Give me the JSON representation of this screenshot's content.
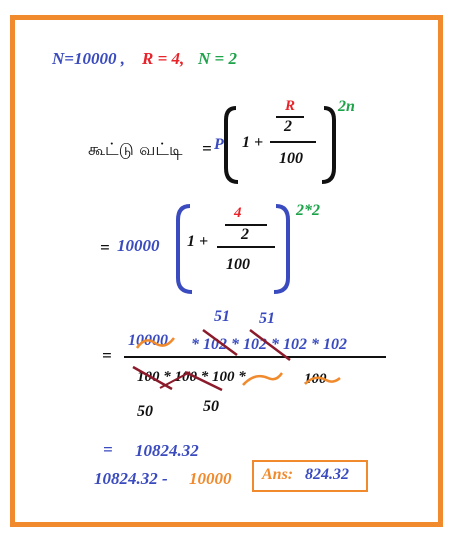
{
  "given": {
    "n_label": "N=10000 ,",
    "r_label": "R = 4,",
    "time_label": "N = 2"
  },
  "formula": {
    "title": "கூட்டு வட்டி",
    "equals": "=",
    "principal": "P",
    "one_plus": "1 +",
    "rate": "R",
    "two": "2",
    "hundred": "100",
    "exponent": "2n"
  },
  "step1": {
    "equals": "=",
    "principal": "10000",
    "one_plus": "1 +",
    "rate": "4",
    "two": "2",
    "hundred": "100",
    "exponent": "2*2"
  },
  "step2": {
    "equals": "=",
    "numerator_first": "10000",
    "numerator_rest": "* 102 * 102 * 102 * 102",
    "cancel_above_1": "51",
    "cancel_above_2": "51",
    "denominator_terms": "100 * 100 * 100 *",
    "denominator_last": "100",
    "cancel_below_1": "50",
    "cancel_below_2": "50"
  },
  "result": {
    "equals": "=",
    "amount": "10824.32",
    "subtraction_amount": "10824.32 -",
    "subtraction_principal": "10000",
    "answer_label": "Ans:",
    "answer_value": "824.32"
  },
  "colors": {
    "border": "#f08a2c",
    "blue": "#3a4bbf",
    "red": "#e8232a",
    "green": "#1da34a",
    "orange": "#f08a2c",
    "strike": "#8b1a2a"
  }
}
